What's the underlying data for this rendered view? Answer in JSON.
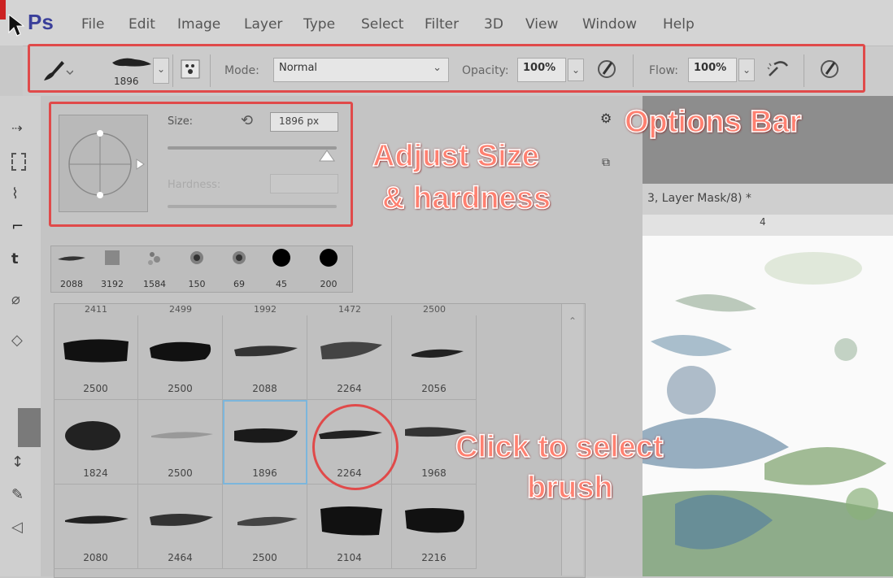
{
  "app": {
    "logo": "Ps"
  },
  "menu": [
    "File",
    "Edit",
    "Image",
    "Layer",
    "Type",
    "Select",
    "Filter",
    "3D",
    "View",
    "Window",
    "Help"
  ],
  "options_bar": {
    "brush_size_preview": "1896",
    "mode_label": "Mode:",
    "mode_value": "Normal",
    "opacity_label": "Opacity:",
    "opacity_value": "100%",
    "flow_label": "Flow:",
    "flow_value": "100%"
  },
  "brush_panel": {
    "size_label": "Size:",
    "size_value": "1896 px",
    "hardness_label": "Hardness:",
    "recent_brushes": [
      "2088",
      "3192",
      "1584",
      "150",
      "69",
      "45",
      "200"
    ],
    "grid_top_labels": [
      "2411",
      "2499",
      "1992",
      "1472",
      "2500"
    ],
    "grid_rows": [
      [
        "2500",
        "2500",
        "2088",
        "2264",
        "2056"
      ],
      [
        "1824",
        "2500",
        "1896",
        "2264",
        "1968"
      ],
      [
        "2080",
        "2464",
        "2500",
        "2104",
        "2216"
      ]
    ],
    "selected_brush": "1896"
  },
  "document": {
    "tab_title": "3, Layer Mask/8) *",
    "ruler_mark": "4"
  },
  "annotations": {
    "options_bar": "Options Bar",
    "adjust_line1": "Adjust Size",
    "adjust_line2": "& hardness",
    "click_line1": "Click to select",
    "click_line2": "brush"
  },
  "colors": {
    "annotation_red": "#e04a4a",
    "selection_blue": "#7cb6dc",
    "ps_logo": "#3a3f9a"
  },
  "icons": [
    "brush-tool-icon",
    "brush-panel-toggle-icon",
    "airbrush-icon",
    "pressure-opacity-icon",
    "pressure-size-icon",
    "gear-icon",
    "new-preset-icon",
    "reset-icon"
  ]
}
